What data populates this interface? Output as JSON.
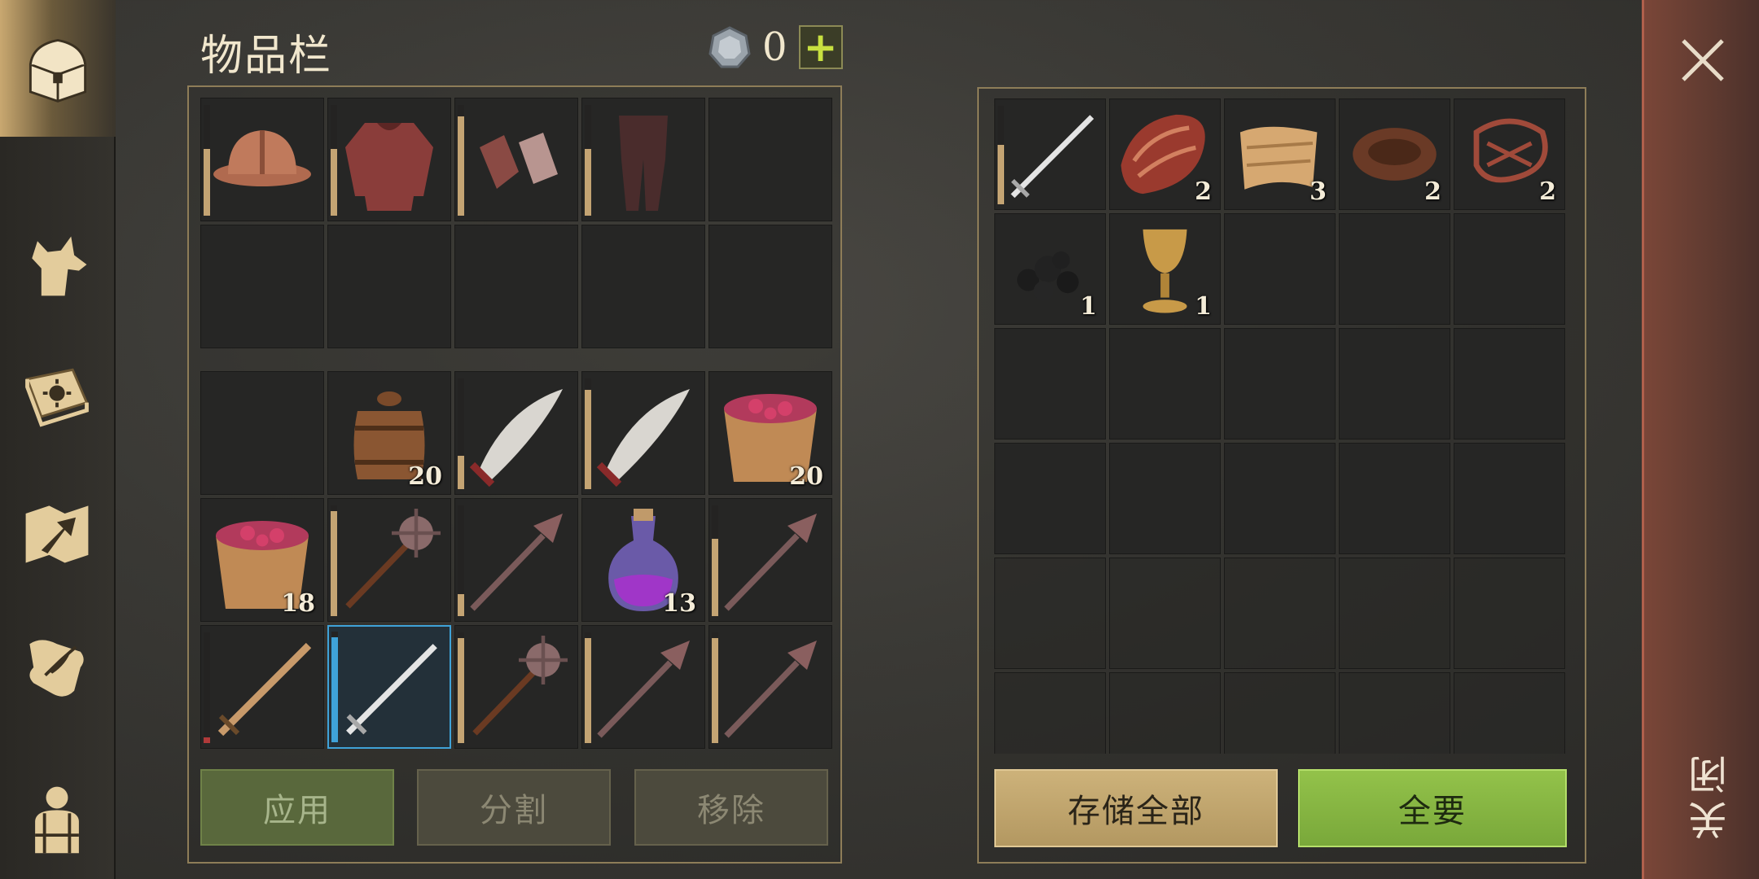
{
  "title": "物品栏",
  "currency": {
    "amount": "0",
    "plus": "+",
    "icon": "silver-coin-icon"
  },
  "sidebar": {
    "tabs": [
      {
        "name": "chest-icon",
        "active": true
      },
      {
        "name": "wolf-icon",
        "active": false
      },
      {
        "name": "sun-book-icon",
        "active": false
      },
      {
        "name": "map-arrow-icon",
        "active": false
      },
      {
        "name": "quill-scroll-icon",
        "active": false
      },
      {
        "name": "character-backpack-icon",
        "active": false
      }
    ]
  },
  "equipment": [
    {
      "item": "helmet",
      "durability": 0.6,
      "color": "#c4a473"
    },
    {
      "item": "chainmail",
      "durability": 0.6,
      "color": "#c4a473"
    },
    {
      "item": "gauntlets",
      "durability": 0.9,
      "color": "#c4a473"
    },
    {
      "item": "chain-leggings",
      "durability": 0.6,
      "color": "#c4a473"
    },
    {
      "item": ""
    },
    {
      "item": ""
    },
    {
      "item": ""
    },
    {
      "item": ""
    },
    {
      "item": ""
    },
    {
      "item": ""
    }
  ],
  "backpack": [
    {
      "item": ""
    },
    {
      "item": "barrel",
      "count": "20"
    },
    {
      "item": "scimitar",
      "durability": 0.3,
      "color": "#c4a473"
    },
    {
      "item": "scimitar",
      "durability": 0.9,
      "color": "#c4a473"
    },
    {
      "item": "berry-bucket",
      "count": "20"
    },
    {
      "item": "berry-bucket",
      "count": "18"
    },
    {
      "item": "morningstar",
      "durability": 0.95,
      "color": "#c4a473"
    },
    {
      "item": "mace",
      "durability": 0.2,
      "color": "#c4a473"
    },
    {
      "item": "potion",
      "count": "13"
    },
    {
      "item": "mace",
      "durability": 0.7,
      "color": "#c4a473"
    },
    {
      "item": "wood-sword",
      "durability": 0.05,
      "color": "#b03a3a"
    },
    {
      "item": "steel-sword",
      "durability": 0.95,
      "color": "#3fa2d8",
      "selected": true
    },
    {
      "item": "morningstar",
      "durability": 0.95,
      "color": "#c4a473"
    },
    {
      "item": "mace",
      "durability": 0.95,
      "color": "#c4a473"
    },
    {
      "item": "mace",
      "durability": 0.95,
      "color": "#c4a473"
    }
  ],
  "storage": [
    {
      "item": "steel-sword",
      "durability": 0.6,
      "color": "#c4a473"
    },
    {
      "item": "raw-meat",
      "count": "2"
    },
    {
      "item": "cloth",
      "count": "3"
    },
    {
      "item": "leather",
      "count": "2"
    },
    {
      "item": "rope-scraps",
      "count": "2"
    },
    {
      "item": "coal",
      "count": "1"
    },
    {
      "item": "goblet",
      "count": "1"
    }
  ],
  "buttons": {
    "apply": "应用",
    "split": "分割",
    "remove": "移除",
    "store_all": "存储全部",
    "take_all": "全要"
  },
  "close": {
    "label": "关闭",
    "icon": "close-x-icon"
  }
}
